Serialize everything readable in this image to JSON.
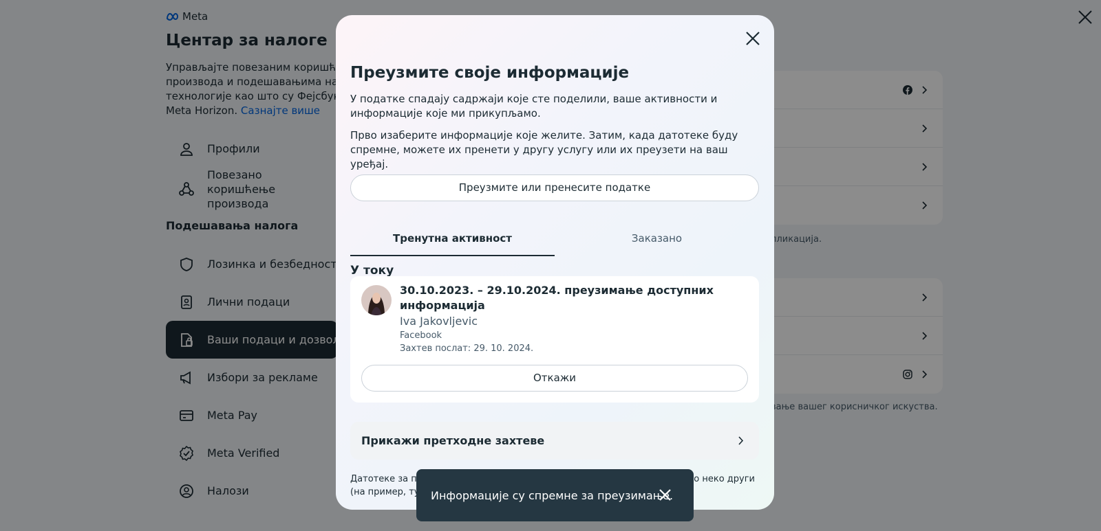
{
  "background": {
    "brand": "Meta",
    "title": "Центар за налоге",
    "description_lines": [
      "Управљајте повезаним коришћењем",
      "производа и подешавањима налога",
      "технологије као што су Фејсбук, Instagram",
      "Meta Horizon."
    ],
    "learn_more": "Сазнајте више",
    "nav_top": [
      {
        "label": "Профили",
        "icon": "person-icon"
      },
      {
        "label": "Повезано коришћење производа",
        "icon": "connected-experiences-icon"
      }
    ],
    "section_title": "Подешавања налога",
    "nav_settings": [
      {
        "label": "Лозинка и безбедност",
        "icon": "shield-icon"
      },
      {
        "label": "Лични подаци",
        "icon": "id-card-icon"
      },
      {
        "label": "Ваши подаци и дозволе",
        "icon": "data-permissions-icon",
        "active": true
      },
      {
        "label": "Избори за рекламе",
        "icon": "megaphone-icon"
      },
      {
        "label": "Meta Pay",
        "icon": "credit-card-icon"
      },
      {
        "label": "Meta Verified",
        "icon": "verified-badge-icon"
      },
      {
        "label": "Налози",
        "icon": "account-circle-icon"
      }
    ],
    "right_note_1": "пликација.",
    "right_note_2": "вање вашег корисничког искуства."
  },
  "modal": {
    "title": "Преузмите своје информације",
    "paragraph1": "У податке спадају садржаји које сте поделили, ваше активности и информације које ми прикупљамо.",
    "paragraph2": "Прво изаберите информације које желите. Затим, када датотеке буду спремне, можете их пренети у другу услугу или их преузети на ваш уређај.",
    "download_button": "Преузмите или пренесите податке",
    "tabs": [
      {
        "label": "Тренутна активност",
        "active": true
      },
      {
        "label": "Заказано",
        "active": false
      }
    ],
    "in_progress_title": "У току",
    "request": {
      "title": "30.10.2023. – 29.10.2024. преузимање доступних информација",
      "name": "Iva Jakovljevic",
      "source": "Facebook",
      "sent": "Захтев послат: 29. 10. 2024.",
      "cancel_button": "Откажи"
    },
    "show_previous": "Прикажи претходне захтеве",
    "footnote_line1_left": "Датотеке за пре",
    "footnote_line1_right": "ио неко други",
    "footnote_line2_left": "(на пример, туђ"
  },
  "toast": {
    "message": "Информације су спремне за преузимање."
  }
}
